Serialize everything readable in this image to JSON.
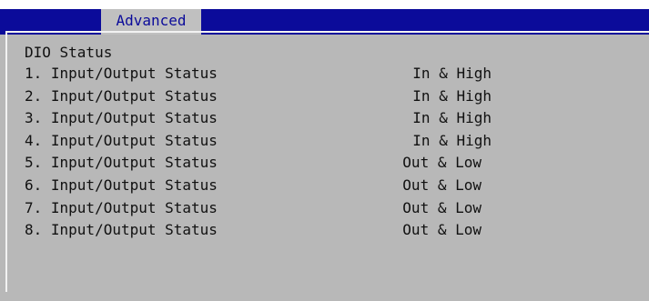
{
  "tabs": [
    {
      "label": "Advanced",
      "active": true
    }
  ],
  "section": {
    "title": "DIO Status"
  },
  "rows": [
    {
      "label": "1. Input/Output Status",
      "value": "In & High"
    },
    {
      "label": "2. Input/Output Status",
      "value": "In & High"
    },
    {
      "label": "3. Input/Output Status",
      "value": "In & High"
    },
    {
      "label": "4. Input/Output Status",
      "value": "In & High"
    },
    {
      "label": "5. Input/Output Status",
      "value": "Out & Low"
    },
    {
      "label": "6. Input/Output Status",
      "value": "Out & Low"
    },
    {
      "label": "7. Input/Output Status",
      "value": "Out & Low"
    },
    {
      "label": "8. Input/Output Status",
      "value": "Out & Low"
    }
  ],
  "colors": {
    "bar": "#0b0b9a",
    "background": "#b8b8b8",
    "tab_background": "#c0c0c0",
    "tab_text": "#0b0b9a",
    "text": "#111111"
  }
}
